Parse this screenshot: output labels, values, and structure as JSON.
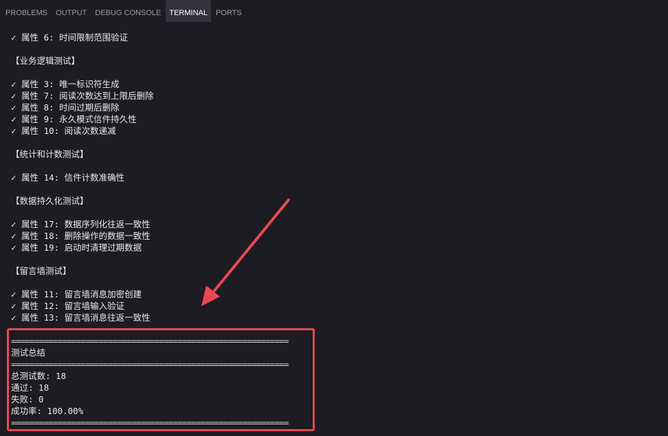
{
  "tabs": {
    "problems": "PROBLEMS",
    "output": "OUTPUT",
    "debug_console": "DEBUG CONSOLE",
    "terminal": "TERMINAL",
    "ports": "PORTS"
  },
  "terminal": {
    "lines": [
      "✓ 属性 6: 时间限制范围验证",
      "",
      "【业务逻辑测试】",
      "",
      "✓ 属性 3: 唯一标识符生成",
      "✓ 属性 7: 阅读次数达到上限后删除",
      "✓ 属性 8: 时间过期后删除",
      "✓ 属性 9: 永久模式信件持久性",
      "✓ 属性 10: 阅读次数递减",
      "",
      "【统计和计数测试】",
      "",
      "✓ 属性 14: 信件计数准确性",
      "",
      "【数据持久化测试】",
      "",
      "✓ 属性 17: 数据序列化往返一致性",
      "✓ 属性 18: 删除操作的数据一致性",
      "✓ 属性 19: 启动时清理过期数据",
      "",
      "【留言墙测试】",
      "",
      "✓ 属性 11: 留言墙消息加密创建",
      "✓ 属性 12: 留言墙输入验证",
      "✓ 属性 13: 留言墙消息往返一致性",
      "",
      "============================================================",
      "测试总结",
      "============================================================",
      "总测试数: 18",
      "通过: 18",
      "失败: 0",
      "成功率: 100.00%",
      "============================================================"
    ]
  },
  "annotation": {
    "box_color": "#e8494f"
  }
}
